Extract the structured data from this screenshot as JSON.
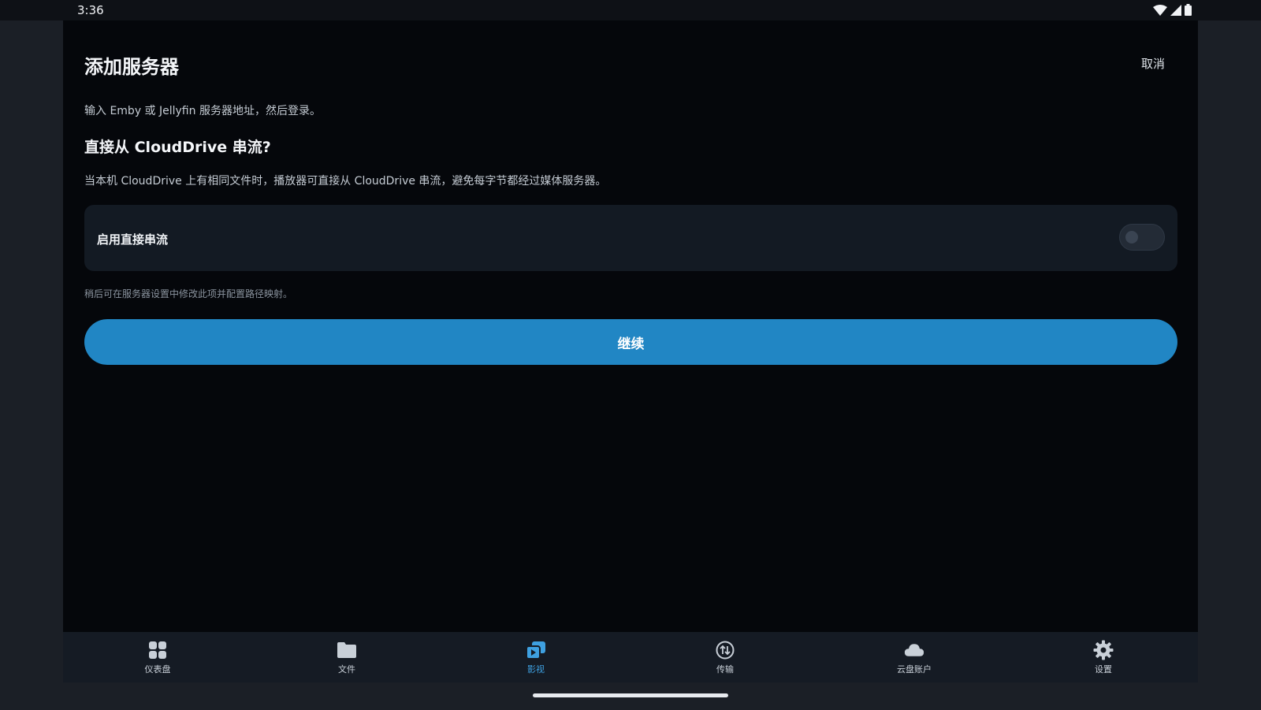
{
  "status_bar": {
    "time": "3:36"
  },
  "header": {
    "title": "添加服务器",
    "cancel_label": "取消"
  },
  "intro": "输入 Emby 或 Jellyfin 服务器地址，然后登录。",
  "section": {
    "title": "直接从 CloudDrive 串流?",
    "description": "当本机 CloudDrive 上有相同文件时，播放器可直接从 CloudDrive 串流，避免每字节都经过媒体服务器。"
  },
  "toggle": {
    "label": "启用直接串流",
    "enabled": false
  },
  "hint": "稍后可在服务器设置中修改此项并配置路径映射。",
  "continue_label": "继续",
  "colors": {
    "accent": "#2186c4",
    "active_nav": "#3ea0e0"
  },
  "nav": {
    "items": [
      {
        "label": "仪表盘",
        "icon": "dashboard-icon",
        "active": false
      },
      {
        "label": "文件",
        "icon": "folder-icon",
        "active": false
      },
      {
        "label": "影视",
        "icon": "media-icon",
        "active": true
      },
      {
        "label": "传输",
        "icon": "transfer-icon",
        "active": false
      },
      {
        "label": "云盘账户",
        "icon": "cloud-icon",
        "active": false
      },
      {
        "label": "设置",
        "icon": "gear-icon",
        "active": false
      }
    ]
  }
}
